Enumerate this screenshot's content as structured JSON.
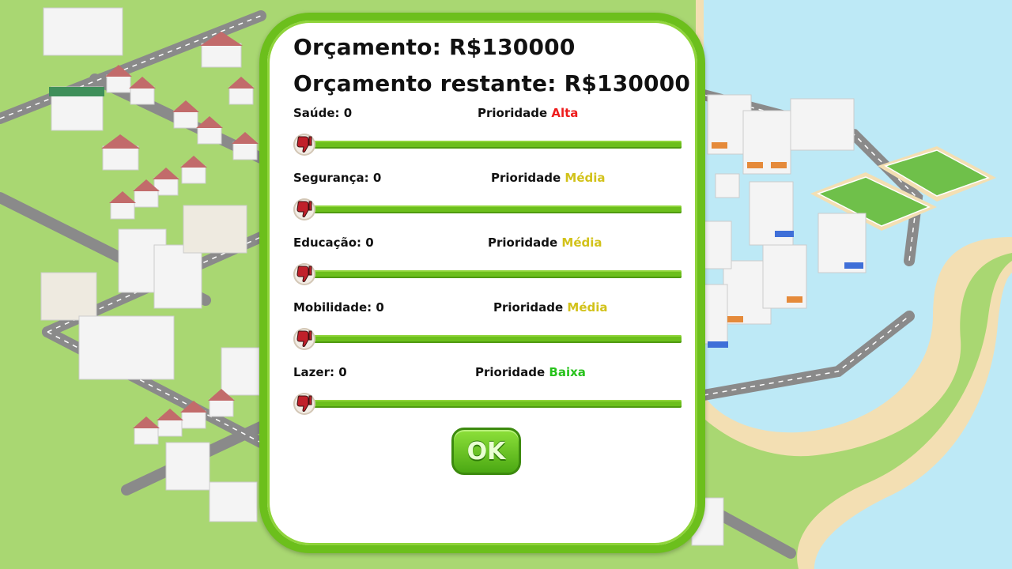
{
  "budget": {
    "total_label": "Orçamento: R$130000",
    "remaining_label": "Orçamento restante: R$130000"
  },
  "sliders": [
    {
      "label": "Saúde: 0",
      "priority_label": "Prioridade",
      "priority": "Alta",
      "priority_color": "#ee1c1c",
      "value": 0
    },
    {
      "label": "Segurança: 0",
      "priority_label": "Prioridade",
      "priority": "Média",
      "priority_color": "#d2c21a",
      "value": 0
    },
    {
      "label": "Educação: 0",
      "priority_label": "Prioridade",
      "priority": "Média",
      "priority_color": "#d2c21a",
      "value": 0
    },
    {
      "label": "Mobilidade: 0",
      "priority_label": "Prioridade",
      "priority": "Média",
      "priority_color": "#d2c21a",
      "value": 0
    },
    {
      "label": "Lazer: 0",
      "priority_label": "Prioridade",
      "priority": "Baixa",
      "priority_color": "#28c21c",
      "value": 0
    }
  ],
  "ok_button": {
    "label": "OK"
  },
  "icons": {
    "slider_knob": "thumbs-down-icon"
  },
  "colors": {
    "panel_border": "#6cbf1c",
    "track": "#6cbf1c",
    "ok_button": "#5cbf1c"
  }
}
